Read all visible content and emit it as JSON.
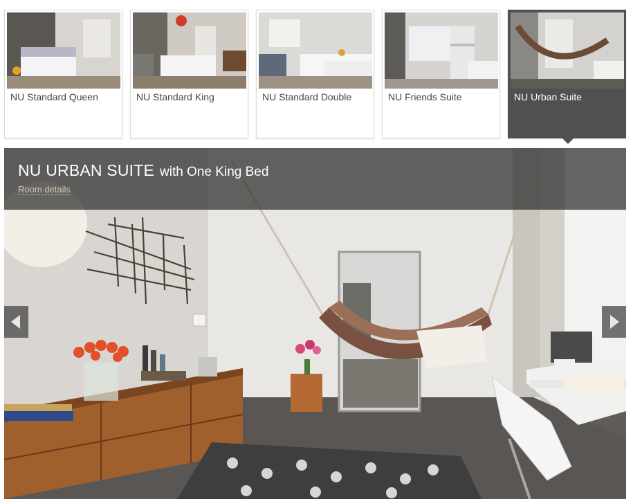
{
  "rooms": [
    {
      "label": "NU Standard Queen",
      "active": false
    },
    {
      "label": "NU Standard King",
      "active": false
    },
    {
      "label": "NU Standard Double",
      "active": false
    },
    {
      "label": "NU Friends Suite",
      "active": false
    },
    {
      "label": "NU Urban Suite",
      "active": true
    }
  ],
  "hero": {
    "title": "NU URBAN SUITE",
    "subtitle": "with One King Bed",
    "details_link": "Room details"
  },
  "icons": {
    "prev": "chevron-left-icon",
    "next": "chevron-right-icon"
  },
  "colors": {
    "active_tab": "#505050",
    "caption_overlay": "#2d2d2d",
    "details_link": "#d0c8b8"
  }
}
